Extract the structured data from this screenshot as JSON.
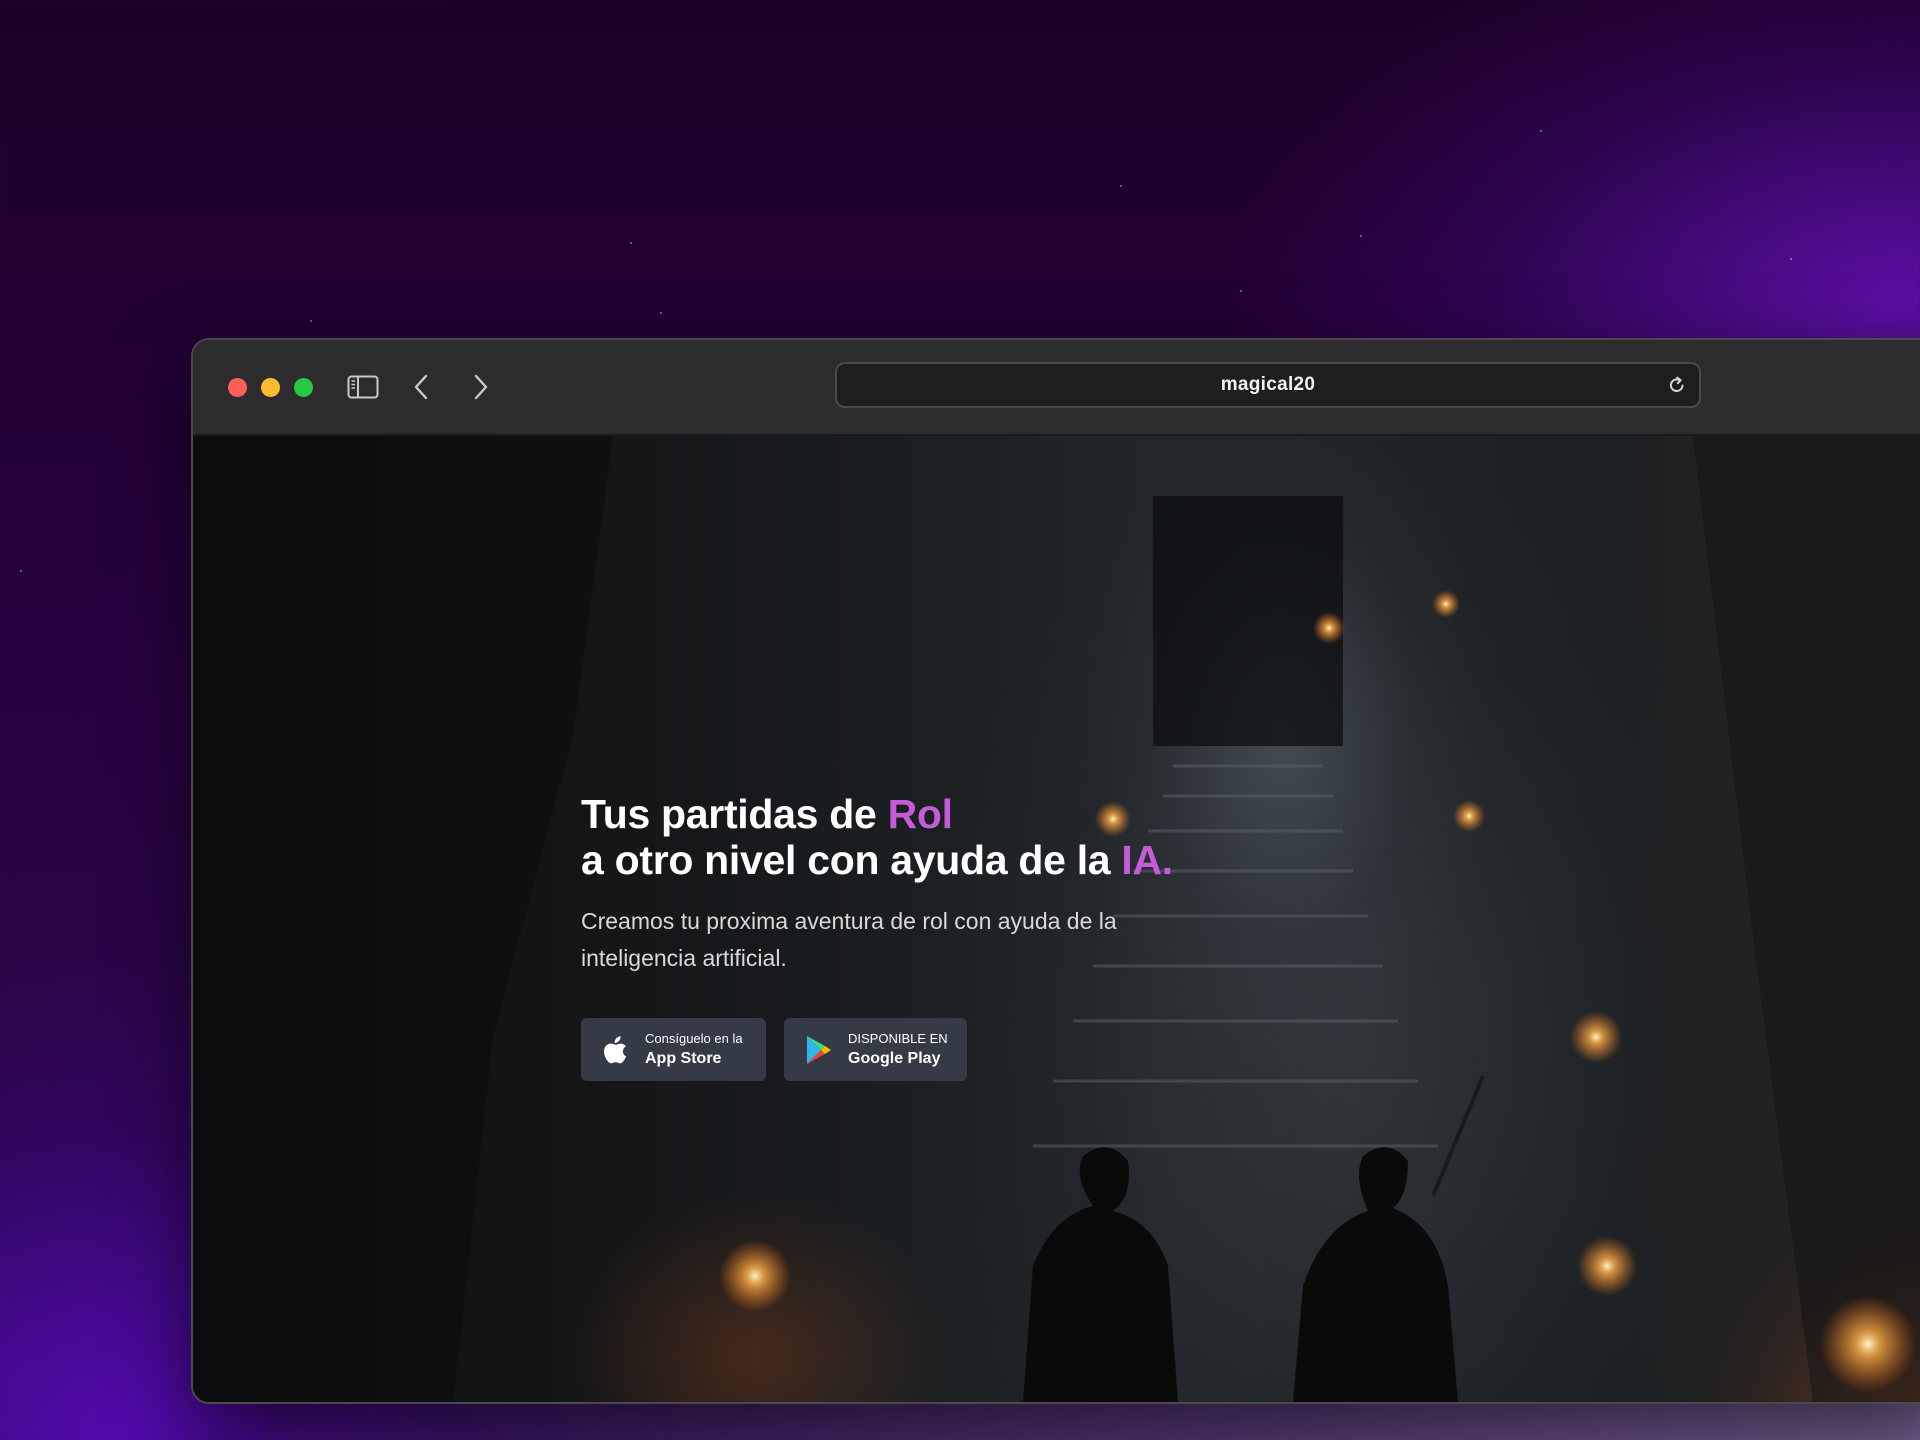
{
  "browser": {
    "url": "magical20",
    "icons": [
      "sidebar-icon",
      "back-arrow-icon",
      "forward-arrow-icon",
      "reload-icon"
    ]
  },
  "hero": {
    "headline_line1_prefix": "Tus partidas de ",
    "headline_line1_accent": "Rol",
    "headline_line2_prefix": "a otro nivel con ayuda de la ",
    "headline_line2_accent": "IA.",
    "subtitle": "Creamos tu proxima aventura de rol con ayuda de la inteligencia artificial."
  },
  "buttons": {
    "app_store": {
      "small": "Consíguelo en la",
      "big": "App Store",
      "icon": "apple-icon"
    },
    "google_play": {
      "small": "DISPONIBLE EN",
      "big": "Google Play",
      "icon": "google-play-icon"
    }
  },
  "colors": {
    "accent": "#c45bd8",
    "button_bg": "#343a46",
    "titlebar": "#2c2c2e"
  }
}
